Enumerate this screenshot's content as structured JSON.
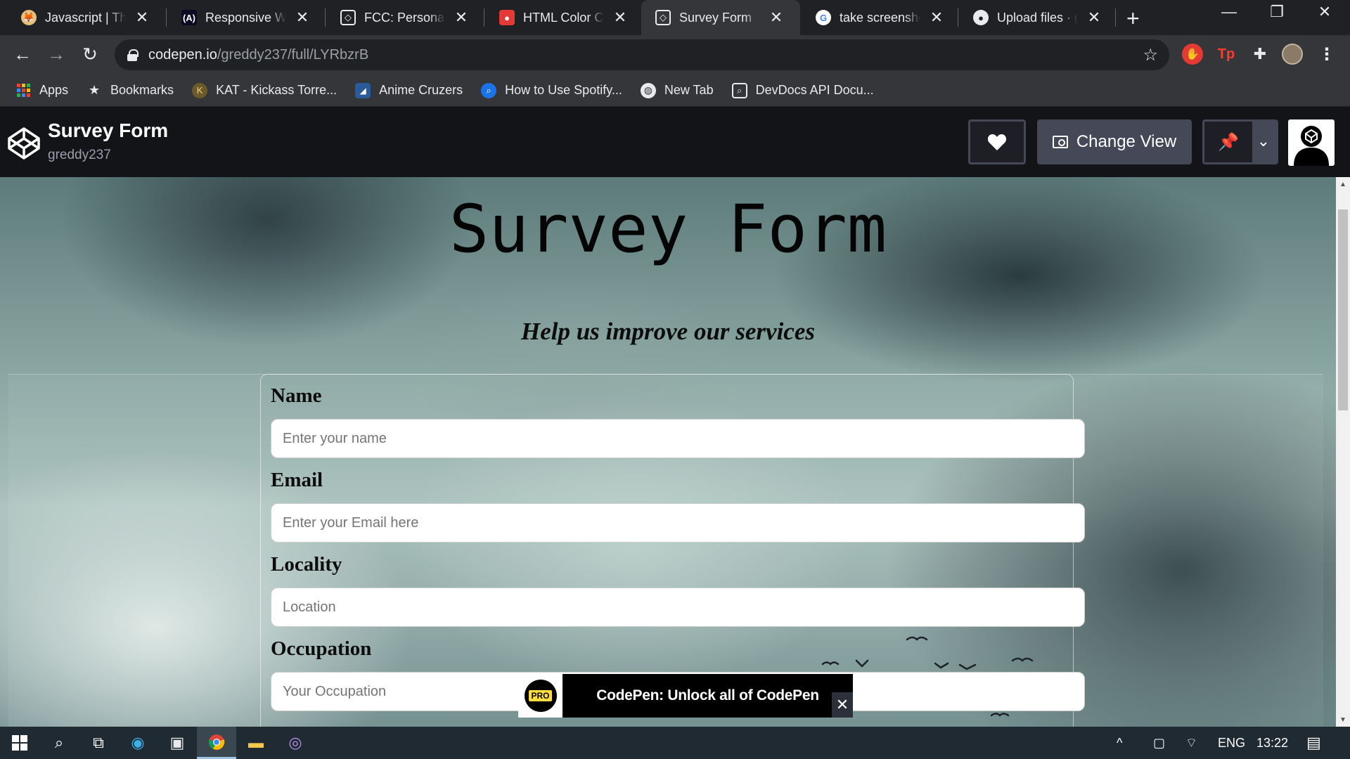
{
  "browser": {
    "tabs": [
      {
        "title": "Javascript | The C",
        "favicon": "fox-icon",
        "active": false
      },
      {
        "title": "Responsive Web",
        "favicon": "fcc-icon",
        "active": false
      },
      {
        "title": "FCC: Personal Po",
        "favicon": "codepen-icon",
        "active": false
      },
      {
        "title": "HTML Color Cod",
        "favicon": "color-icon",
        "active": false
      },
      {
        "title": "Survey Form",
        "favicon": "codepen-icon",
        "active": true
      },
      {
        "title": "take screenshot",
        "favicon": "google-icon",
        "active": false
      },
      {
        "title": "Upload files · gi",
        "favicon": "github-icon",
        "active": false
      }
    ],
    "address": {
      "host": "codepen.io",
      "path": "/greddy237/full/LYRbzrB"
    },
    "bookmarks": [
      {
        "label": "Apps",
        "icon": "apps-grid-icon"
      },
      {
        "label": "Bookmarks",
        "icon": "star-icon"
      },
      {
        "label": "KAT - Kickass Torre...",
        "icon": "kat-icon"
      },
      {
        "label": "Anime Cruzers",
        "icon": "anime-icon"
      },
      {
        "label": "How to Use Spotify...",
        "icon": "search-icon"
      },
      {
        "label": "New Tab",
        "icon": "globe-icon"
      },
      {
        "label": "DevDocs API Docu...",
        "icon": "devdocs-icon"
      }
    ]
  },
  "codepen": {
    "title": "Survey Form",
    "user": "greddy237",
    "change_view_label": "Change View"
  },
  "page": {
    "title": "Survey Form",
    "subtitle": "Help us improve our services",
    "fields": [
      {
        "label": "Name",
        "placeholder": "Enter your name"
      },
      {
        "label": "Email",
        "placeholder": "Enter your Email here"
      },
      {
        "label": "Locality",
        "placeholder": "Location"
      },
      {
        "label": "Occupation",
        "placeholder": "Your Occupation"
      }
    ]
  },
  "toast": {
    "badge": "PRO",
    "message": "CodePen: Unlock all of CodePen"
  },
  "taskbar": {
    "language": "ENG",
    "time": "13:22"
  },
  "colors": {
    "codepen_header": "#131417",
    "chrome_dark": "#202124",
    "chrome_toolbar": "#35363a",
    "taskbar": "#1f2a33"
  }
}
